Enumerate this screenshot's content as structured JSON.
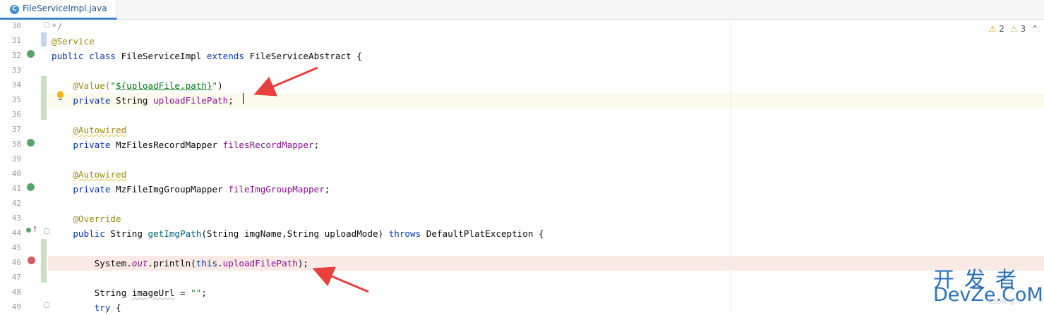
{
  "tab": {
    "icon_letter": "C",
    "filename": "FileServiceImpl.java"
  },
  "inspections": {
    "warnings": "2",
    "weak_warnings": "3",
    "warn_glyph": "⚠",
    "weak_glyph": "⚠",
    "chevron": "⌃"
  },
  "lines": [
    {
      "n": "30",
      "tokens": [
        {
          "t": "*/",
          "c": "cm"
        }
      ]
    },
    {
      "n": "31",
      "tokens": [
        {
          "t": "@Service",
          "c": "ann"
        }
      ]
    },
    {
      "n": "32",
      "tokens": [
        {
          "t": "public ",
          "c": "kw"
        },
        {
          "t": "class ",
          "c": "kw"
        },
        {
          "t": "FileServiceImpl ",
          "c": "pl"
        },
        {
          "t": "extends ",
          "c": "kw"
        },
        {
          "t": "FileServiceAbstract {",
          "c": "pl"
        }
      ]
    },
    {
      "n": "33",
      "tokens": []
    },
    {
      "n": "34",
      "tokens": [
        {
          "t": "    @Value(",
          "c": "ann"
        },
        {
          "t": "\"",
          "c": "str"
        },
        {
          "t": "${uploadFile.path}",
          "c": "str-ul"
        },
        {
          "t": "\"",
          "c": "str"
        },
        {
          "t": ")",
          "c": "pl"
        }
      ]
    },
    {
      "n": "35",
      "tokens": [
        {
          "t": "    private ",
          "c": "kw"
        },
        {
          "t": "String ",
          "c": "pl"
        },
        {
          "t": "uploadFilePath",
          "c": "fld"
        },
        {
          "t": ";",
          "c": "pl"
        }
      ]
    },
    {
      "n": "36",
      "tokens": []
    },
    {
      "n": "37",
      "tokens": [
        {
          "t": "    ",
          "c": "pl"
        },
        {
          "t": "@Autowired",
          "c": "ann-w"
        }
      ]
    },
    {
      "n": "38",
      "tokens": [
        {
          "t": "    private ",
          "c": "kw"
        },
        {
          "t": "MzFilesRecordMapper ",
          "c": "pl"
        },
        {
          "t": "filesRecordMapper",
          "c": "fld"
        },
        {
          "t": ";",
          "c": "pl"
        }
      ]
    },
    {
      "n": "39",
      "tokens": []
    },
    {
      "n": "40",
      "tokens": [
        {
          "t": "    ",
          "c": "pl"
        },
        {
          "t": "@Autowired",
          "c": "ann-w"
        }
      ]
    },
    {
      "n": "41",
      "tokens": [
        {
          "t": "    private ",
          "c": "kw"
        },
        {
          "t": "MzFileImgGroupMapper ",
          "c": "pl"
        },
        {
          "t": "fileImgGroupMapper",
          "c": "fld"
        },
        {
          "t": ";",
          "c": "pl"
        }
      ]
    },
    {
      "n": "42",
      "tokens": []
    },
    {
      "n": "43",
      "tokens": [
        {
          "t": "    @Override",
          "c": "ann"
        }
      ]
    },
    {
      "n": "44",
      "tokens": [
        {
          "t": "    public ",
          "c": "kw"
        },
        {
          "t": "String ",
          "c": "pl"
        },
        {
          "t": "getImgPath",
          "c": "mth"
        },
        {
          "t": "(String imgName,String uploadMode) ",
          "c": "pl"
        },
        {
          "t": "throws ",
          "c": "kw"
        },
        {
          "t": "DefaultPlatException {",
          "c": "pl"
        }
      ]
    },
    {
      "n": "45",
      "tokens": []
    },
    {
      "n": "46",
      "tokens": [
        {
          "t": "        System.",
          "c": "pl"
        },
        {
          "t": "out",
          "c": "fld-i"
        },
        {
          "t": ".println(",
          "c": "pl"
        },
        {
          "t": "this",
          "c": "kw"
        },
        {
          "t": ".",
          "c": "pl"
        },
        {
          "t": "uploadFilePath",
          "c": "fld"
        },
        {
          "t": ");",
          "c": "pl"
        }
      ]
    },
    {
      "n": "47",
      "tokens": []
    },
    {
      "n": "48",
      "tokens": [
        {
          "t": "        String ",
          "c": "pl"
        },
        {
          "t": "imageUrl",
          "c": "pl-ul"
        },
        {
          "t": " = ",
          "c": "pl"
        },
        {
          "t": "\"\"",
          "c": "str"
        },
        {
          "t": ";",
          "c": "pl"
        }
      ]
    },
    {
      "n": "49",
      "tokens": [
        {
          "t": "        try ",
          "c": "kw"
        },
        {
          "t": "{",
          "c": "pl"
        }
      ]
    }
  ],
  "watermark": {
    "top": "开发者",
    "bottom": "DevZe.CoM",
    "small": "CSDN @..."
  },
  "colors": {
    "accent": "#4083c9",
    "annotation": "#9e880d",
    "keyword": "#0033b3",
    "field": "#871094",
    "string": "#067d17",
    "arrow": "#e8403c",
    "breakpoint_row": "#faeae6",
    "caret_row": "#fcfaed"
  }
}
